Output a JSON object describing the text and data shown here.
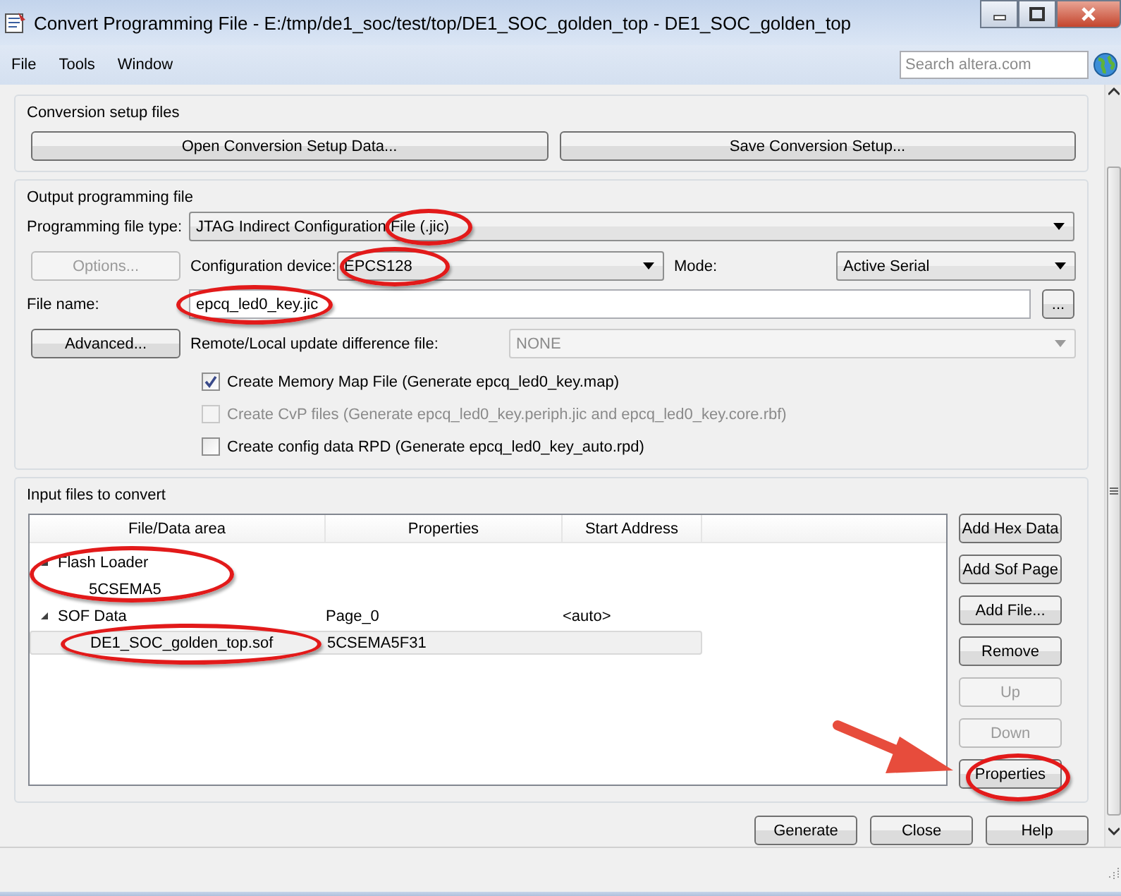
{
  "window": {
    "title": "Convert Programming File - E:/tmp/de1_soc/test/top/DE1_SOC_golden_top - DE1_SOC_golden_top"
  },
  "menu": [
    {
      "label": "File"
    },
    {
      "label": "Tools"
    },
    {
      "label": "Window"
    }
  ],
  "search": {
    "placeholder": "Search altera.com"
  },
  "conversion_setup": {
    "title": "Conversion setup files",
    "buttons": [
      "Open Conversion Setup Data...",
      "Save Conversion Setup..."
    ]
  },
  "output": {
    "title": "Output programming file",
    "file_type": {
      "label": "Programming file type:",
      "value": "JTAG Indirect Configuration File (.jic)",
      "circled": true
    },
    "options_button": {
      "label": "Options...",
      "disabled": true
    },
    "device": {
      "label": "Configuration device:",
      "value": "EPCS128",
      "circled": true
    },
    "mode": {
      "label": "Mode:",
      "value": "Active Serial"
    },
    "file_name": {
      "label": "File name:",
      "value": "epcq_led0_key.jic",
      "circled": true
    },
    "browse_button": "...",
    "advanced_button": {
      "label": "Advanced...",
      "disabled": false
    },
    "difference_file": {
      "label": "Remote/Local update difference file:",
      "value": "NONE",
      "disabled": true
    },
    "checkboxes": [
      {
        "label": "Create Memory Map File (Generate epcq_led0_key.map)",
        "checked": true,
        "disabled": false
      },
      {
        "label": "Create CvP files (Generate epcq_led0_key.periph.jic and epcq_led0_key.core.rbf)",
        "checked": false,
        "disabled": true
      },
      {
        "label": "Create config data RPD (Generate epcq_led0_key_auto.rpd)",
        "checked": false,
        "disabled": false
      }
    ]
  },
  "input_files": {
    "title": "Input files to convert",
    "columns": [
      "File/Data area",
      "Properties",
      "Start Address"
    ],
    "items": [
      {
        "name": "Flash Loader",
        "expanded": true,
        "circled": true,
        "selected": false,
        "children": [
          {
            "name": "5CSEMA5",
            "selected": false
          }
        ]
      },
      {
        "name": "SOF Data",
        "properties": "Page_0",
        "start_address": "<auto>",
        "expanded": true,
        "selected": false,
        "children": [
          {
            "name": "DE1_SOC_golden_top.sof",
            "properties": "5CSEMA5F31",
            "selected": true,
            "circled": true
          }
        ]
      }
    ],
    "buttons": [
      {
        "label": "Add Hex Data",
        "disabled": false,
        "pointed": false
      },
      {
        "label": "Add Sof Page",
        "disabled": false,
        "pointed": false
      },
      {
        "label": "Add File...",
        "disabled": false,
        "pointed": false
      },
      {
        "label": "Remove",
        "disabled": false,
        "pointed": false
      },
      {
        "label": "Up",
        "disabled": true,
        "pointed": false
      },
      {
        "label": "Down",
        "disabled": true,
        "pointed": false
      },
      {
        "label": "Properties",
        "disabled": false,
        "pointed": true
      }
    ]
  },
  "footer_buttons": [
    "Generate",
    "Close",
    "Help"
  ]
}
